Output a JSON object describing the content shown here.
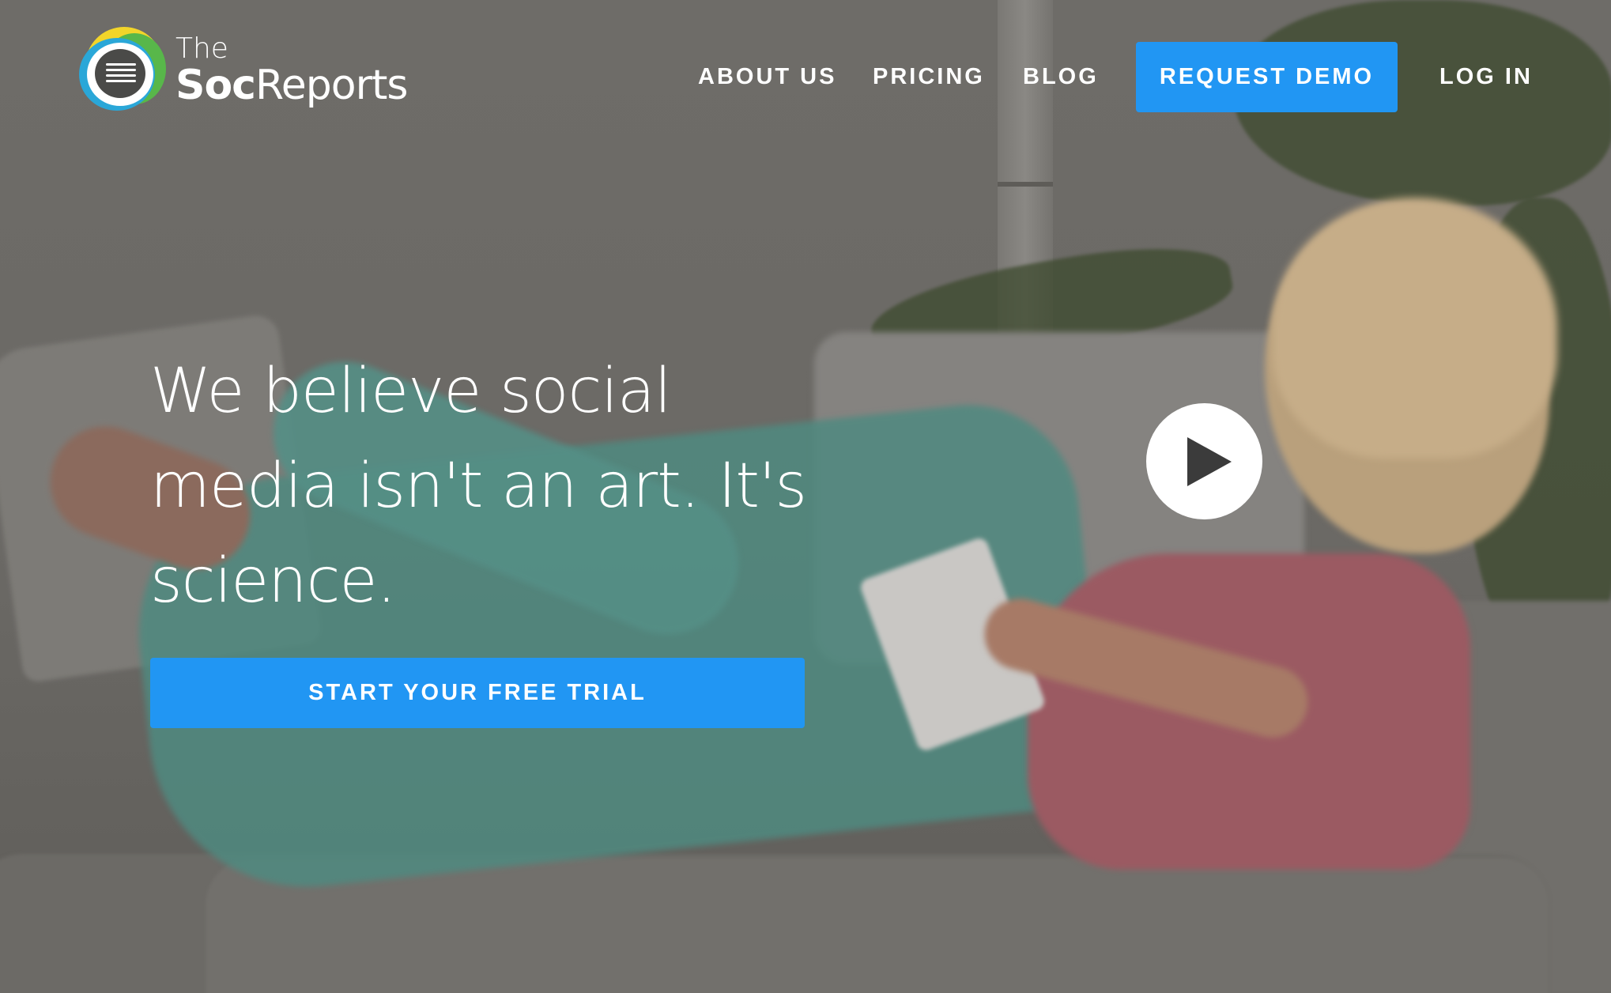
{
  "brand": {
    "the": "The",
    "name_bold": "Soc",
    "name_regular": "Reports",
    "logo_colors": [
      "#f2d52a",
      "#58b74a",
      "#2aa7d8"
    ]
  },
  "nav": {
    "about": "ABOUT US",
    "pricing": "PRICING",
    "blog": "BLOG",
    "request_demo": "REQUEST DEMO",
    "login": "LOG IN"
  },
  "hero": {
    "headline": "We believe social media isn't an art. It's science.",
    "cta": "START YOUR FREE TRIAL",
    "play_icon": "play-icon"
  },
  "colors": {
    "accent": "#2196f3",
    "text": "#ffffff"
  }
}
